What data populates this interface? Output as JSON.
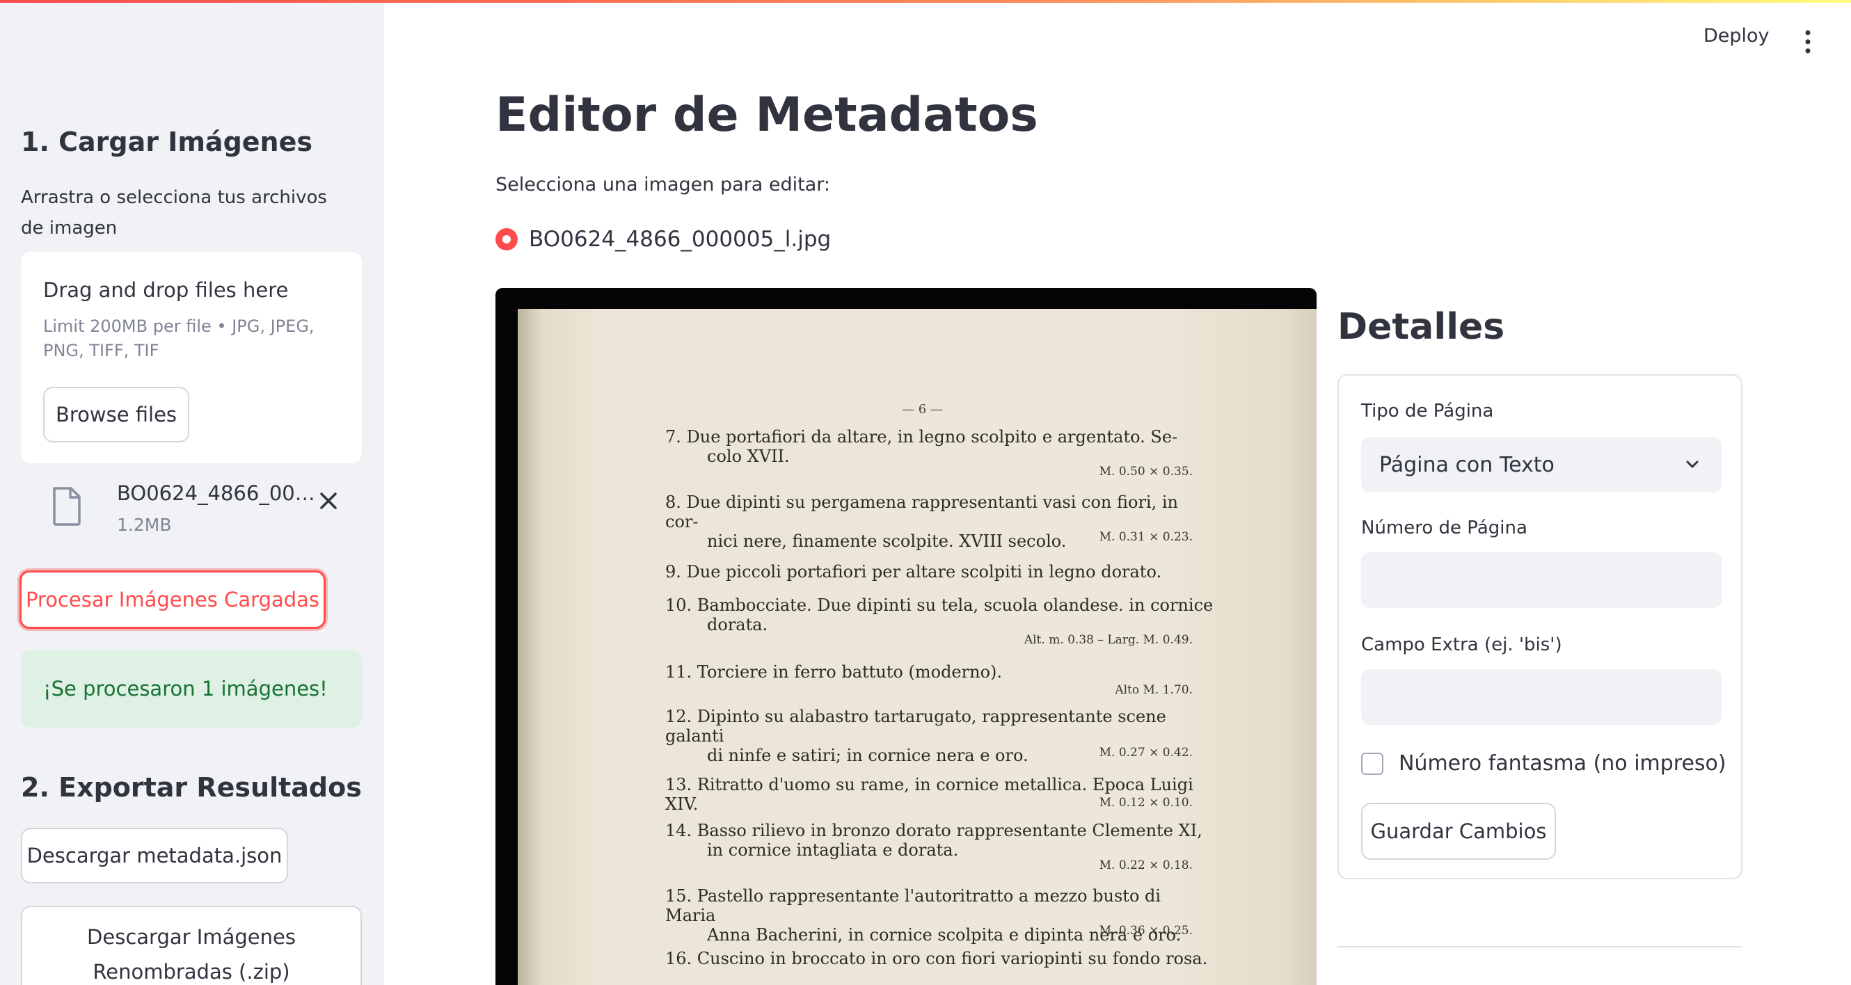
{
  "header": {
    "deploy_label": "Deploy",
    "menu_icon": "kebab-menu-icon"
  },
  "sidebar": {
    "section1_title": "1. Cargar Imágenes",
    "upload_instructions": "Arrastra o selecciona tus archivos de imagen",
    "dropzone": {
      "title": "Drag and drop files here",
      "limit": "Limit 200MB per file • JPG, JPEG, PNG, TIFF, TIF",
      "browse_label": "Browse files"
    },
    "uploaded_file": {
      "name": "BO0624_4866_000005_l.jpg",
      "size": "1.2MB",
      "icon": "file-icon"
    },
    "process_label": "Procesar Imágenes Cargadas",
    "success_message": "¡Se procesaron 1 imágenes!",
    "section2_title": "2. Exportar Resultados",
    "download_json_label": "Descargar metadata.json",
    "download_zip_label": "Descargar Imágenes Renombradas (.zip)"
  },
  "main": {
    "title": "Editor de Metadatos",
    "select_prompt": "Selecciona una imagen para editar:",
    "images": [
      "BO0624_4866_000005_l.jpg"
    ],
    "selected_image": "BO0624_4866_000005_l.jpg",
    "document": {
      "page_number": "— 6 —",
      "entries": [
        {
          "line1": "7. Due portafiori da altare, in legno scolpito e argentato. Se-",
          "line2": "colo XVII.",
          "measure": "M. 0.50 ⨯ 0.35."
        },
        {
          "line1": "8. Due dipinti su pergamena rappresentanti vasi con fiori, in cor-",
          "line2": "nici nere, finamente scolpite. XVIII secolo.",
          "measure": "M. 0.31 ⨯ 0.23."
        },
        {
          "line1": "9. Due piccoli portafiori per altare scolpiti in legno dorato.",
          "line2": "",
          "measure": ""
        },
        {
          "line1": "10. Bambocciate. Due dipinti su tela, scuola olandese. in cornice",
          "line2": "dorata.",
          "measure": "Alt. m. 0.38 – Larg. M. 0.49."
        },
        {
          "line1": "11. Torciere in ferro battuto (moderno).",
          "line2": "",
          "measure": "Alto M. 1.70."
        },
        {
          "line1": "12. Dipinto su alabastro tartarugato, rappresentante scene galanti",
          "line2": "di ninfe e satiri; in cornice nera e oro.",
          "measure": "M. 0.27 ⨯ 0.42."
        },
        {
          "line1": "13. Ritratto d'uomo su rame, in cornice metallica. Epoca Luigi XIV.",
          "line2": "",
          "measure": "M. 0.12 ⨯ 0.10."
        },
        {
          "line1": "14. Basso rilievo in bronzo dorato rappresentante Clemente XI,",
          "line2": "in cornice intagliata e dorata.",
          "measure": "M. 0.22 ⨯ 0.18."
        },
        {
          "line1": "15. Pastello rappresentante l'autoritratto a mezzo busto di Maria",
          "line2": "Anna Bacherini, in cornice scolpita e dipinta nera e oro.",
          "measure": "M. 0.36 ⨯ 0.25."
        },
        {
          "line1": "16. Cuscino in broccato in oro con fiori variopinti su fondo rosa.",
          "line2": "",
          "measure": ""
        }
      ]
    },
    "details": {
      "title": "Detalles",
      "page_type_label": "Tipo de Página",
      "page_type_value": "Página con Texto",
      "page_number_label": "Número de Página",
      "page_number_value": "",
      "extra_field_label": "Campo Extra (ej. 'bis')",
      "extra_field_value": "",
      "ghost_number_label": "Número fantasma (no impreso)",
      "ghost_number_checked": false,
      "save_label": "Guardar Cambios"
    }
  },
  "colors": {
    "accent": "#ff4b4b",
    "success_bg": "#dff0e5",
    "success_text": "#177233",
    "sidebar_bg": "#f0f2f6"
  }
}
